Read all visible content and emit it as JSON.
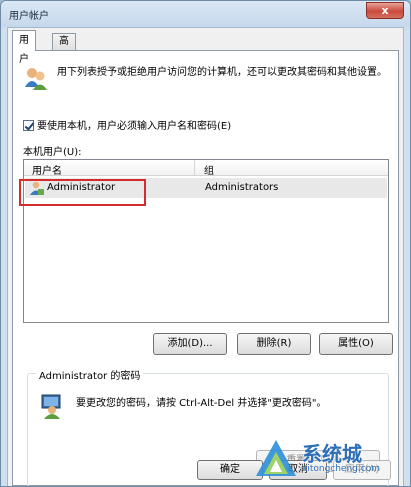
{
  "window": {
    "title": "用户帐户",
    "close_label": "x"
  },
  "tabs": [
    {
      "label": "用户",
      "active": true
    },
    {
      "label": "高级",
      "active": false
    }
  ],
  "description": "用下列表授予或拒绝用户访问您的计算机，还可以更改其密码和其他设置。",
  "require_login": {
    "label": "要使用本机，用户必须输入用户名和密码(E)",
    "checked": true
  },
  "local_users": {
    "label": "本机用户(U):",
    "columns": [
      "用户名",
      "组"
    ],
    "rows": [
      {
        "name": "Administrator",
        "group": "Administrators"
      }
    ]
  },
  "buttons": {
    "add": "添加(D)...",
    "remove": "删除(R)",
    "properties": "属性(O)"
  },
  "password_group": {
    "title": "Administrator 的密码",
    "text": "要更改您的密码，请按 Ctrl-Alt-Del 并选择\"更改密码\"。",
    "reset_button": "重置密码(P)..."
  },
  "footer": {
    "ok": "确定",
    "cancel": "取消",
    "apply": "应用(A)"
  },
  "watermark": {
    "brand": "系统城",
    "url": "xitongcheng.com"
  }
}
